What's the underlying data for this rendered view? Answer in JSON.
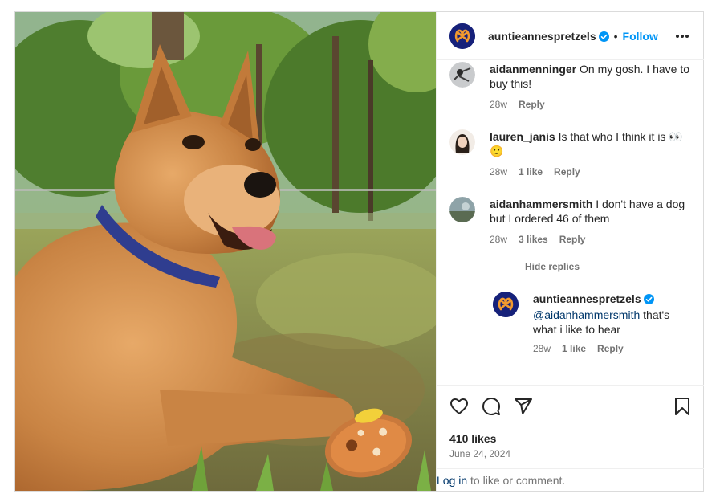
{
  "post": {
    "author": {
      "username": "auntieannespretzels",
      "follow_label": "Follow",
      "separator": "•"
    },
    "comments": [
      {
        "username": "aidanmenninger",
        "text": "On my gosh. I have to buy this!",
        "time": "28w",
        "likes": "",
        "reply": "Reply"
      },
      {
        "username": "lauren_janis",
        "text": "Is that who I think it is 👀 🙂",
        "time": "28w",
        "likes": "1 like",
        "reply": "Reply"
      },
      {
        "username": "aidanhammersmith",
        "text": "I don't have a dog but I ordered 46 of them",
        "time": "28w",
        "likes": "3 likes",
        "reply": "Reply"
      }
    ],
    "hide_replies_label": "Hide replies",
    "reply": {
      "username": "auntieannespretzels",
      "mention": "@aidanhammersmith",
      "text": "that's what i like to hear",
      "time": "28w",
      "likes": "1 like",
      "reply": "Reply"
    },
    "likes": "410 likes",
    "date": "June 24, 2024",
    "footer": {
      "login": "Log in",
      "rest": "to like or comment."
    }
  },
  "colors": {
    "brand_navy": "#16217a",
    "brand_orange": "#f29a2e",
    "link_blue": "#0095f6",
    "verified_blue": "#0095f6"
  },
  "icons": [
    "pretzel-logo-icon",
    "verified-icon",
    "more-options-icon",
    "heart-icon",
    "comment-icon",
    "share-icon",
    "save-icon"
  ]
}
